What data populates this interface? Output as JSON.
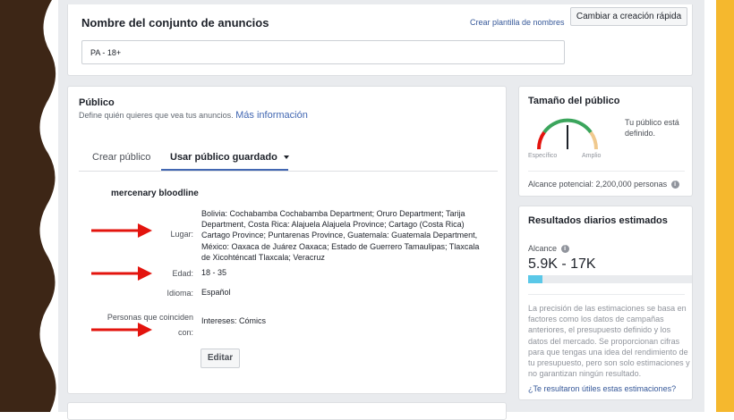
{
  "top_card": {
    "title": "Nombre del conjunto de anuncios",
    "create_template_link": "Crear plantilla de nombres",
    "quick_create_button": "Cambiar a creación rápida",
    "name_value": "PA - 18+"
  },
  "audience": {
    "title": "Público",
    "subtitle": "Define quién quieres que vea tus anuncios.",
    "more_info_link": "Más información",
    "tabs": [
      {
        "label": "Crear público",
        "active": false
      },
      {
        "label": "Usar público guardado",
        "active": true
      }
    ],
    "saved_name": "mercenary bloodline",
    "fields": {
      "location_label": "Lugar:",
      "location_lines": [
        "Bolivia: Cochabamba Cochabamba Department; Oruro Department; Tarija",
        "Department, Costa Rica: Alajuela Alajuela Province; Cartago (Costa Rica)",
        "Cartago Province; Puntarenas Province, Guatemala: Guatemala Department,",
        "México: Oaxaca de Juárez Oaxaca; Estado de Guerrero Tamaulipas; Tlaxcala",
        "de Xicohténcatl Tlaxcala; Veracruz"
      ],
      "age_label": "Edad:",
      "age_value": "18 - 35",
      "language_label": "Idioma:",
      "language_value": "Español",
      "match_label_line1": "Personas que coinciden",
      "match_label_line2": "con:",
      "match_value": "Intereses: Cómics"
    },
    "edit_button": "Editar"
  },
  "audience_size": {
    "title": "Tamaño del público",
    "description_line1": "Tu público está",
    "description_line2": "definido.",
    "gauge_left_label": "Específico",
    "gauge_right_label": "Amplio",
    "potential_reach": "Alcance potencial: 2,200,000 personas",
    "info_icon": "info-icon"
  },
  "daily_results": {
    "title": "Resultados diarios estimados",
    "reach_label": "Alcance",
    "reach_value": "5.9K - 17K",
    "reach_bar_fraction": 0.09,
    "description_lines": [
      "La precisión de las estimaciones se basa en",
      "factores como los datos de campañas",
      "anteriores, el presupuesto definido y los",
      "datos del mercado. Se proporcionan cifras",
      "para que tengas una idea del rendimiento de",
      "tu presupuesto, pero son solo estimaciones y",
      "no garantizan ningún resultado."
    ],
    "feedback_link": "¿Te resultaron útiles estas estimaciones?"
  },
  "colors": {
    "link": "#365899",
    "accent": "#4267b2",
    "annotation_arrow": "#e3140e",
    "deco_left": "#3d2616",
    "deco_right": "#f5b82e",
    "bar_fill": "#5ac8e8"
  }
}
